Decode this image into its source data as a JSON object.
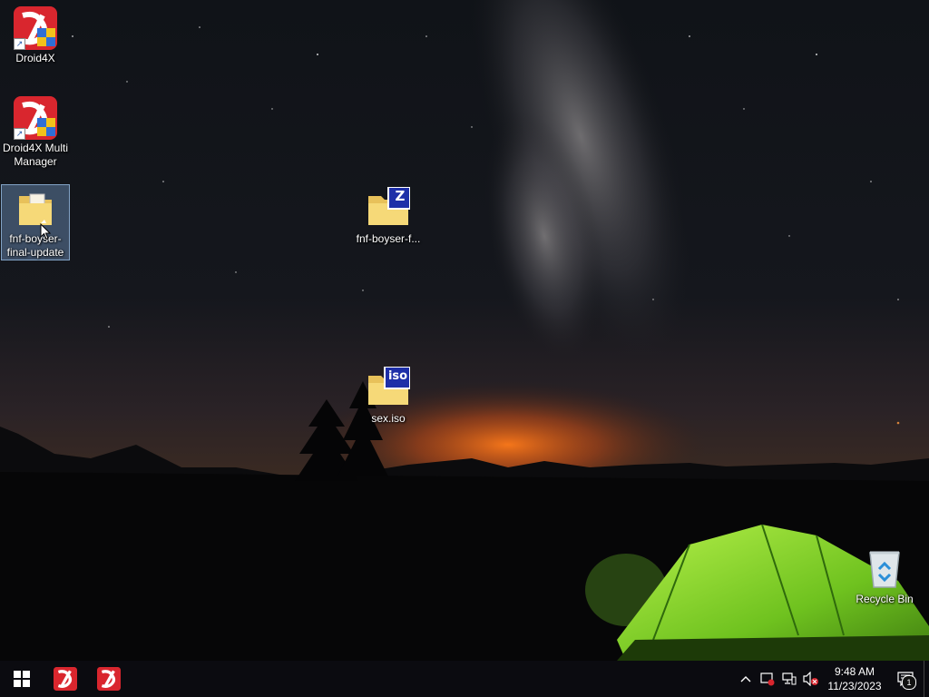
{
  "desktop": {
    "icons": [
      {
        "label": "Droid4X",
        "icon": "droid4x-app-icon",
        "shortcut": true
      },
      {
        "label": "Droid4X Multi Manager",
        "icon": "droid4x-multi-manager-icon",
        "shortcut": true
      },
      {
        "label": "fnf-boyser-final-update",
        "icon": "folder-icon",
        "selected": true
      },
      {
        "label": "fnf-boyser-f...",
        "icon": "zip-archive-icon",
        "badge": "Z"
      },
      {
        "label": "sex.iso",
        "icon": "iso-archive-icon",
        "badge": "iso"
      },
      {
        "label": "Recycle Bin",
        "icon": "recycle-bin-icon"
      }
    ]
  },
  "taskbar": {
    "start": "start-button",
    "pinned": [
      "droid4x-taskbar-icon",
      "droid4x-multi-manager-taskbar-icon"
    ],
    "tray": {
      "icons": [
        "chevron-up-icon",
        "action-center-flag-icon",
        "network-icon",
        "volume-muted-icon"
      ],
      "clock_time": "9:48 AM",
      "clock_date": "11/23/2023",
      "notification_count": "1"
    }
  },
  "colors": {
    "taskbar": "#0b0b10",
    "selection": "#82aadc",
    "droid_red": "#d9262e",
    "tent_green": "#7fd12a",
    "horizon_orange": "#e8651a"
  }
}
